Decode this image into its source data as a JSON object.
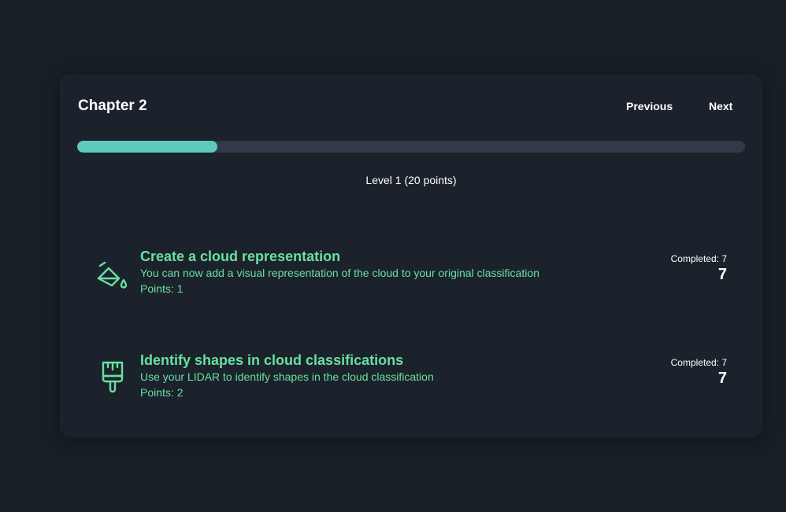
{
  "colors": {
    "background": "#1c222b",
    "accent_green": "#68e0a1",
    "progress_fill": "#5ccbbd",
    "progress_track": "#303a48"
  },
  "chapter": {
    "title": "Chapter 2",
    "previous_label": "Previous",
    "next_label": "Next",
    "progress_fraction": 0.21,
    "level_label": "Level 1 (20 points)"
  },
  "tasks": [
    {
      "icon": "paint-bucket-icon",
      "title": "Create a cloud representation",
      "description": "You can now add a visual representation of the cloud to your original classification",
      "points": "Points: 1",
      "completed": "Completed: 7",
      "count": "7"
    },
    {
      "icon": "paintbrush-icon",
      "title": "Identify shapes in cloud classifications",
      "description": "Use your LIDAR to identify shapes in the cloud classification",
      "points": "Points: 2",
      "completed": "Completed: 7",
      "count": "7"
    }
  ]
}
